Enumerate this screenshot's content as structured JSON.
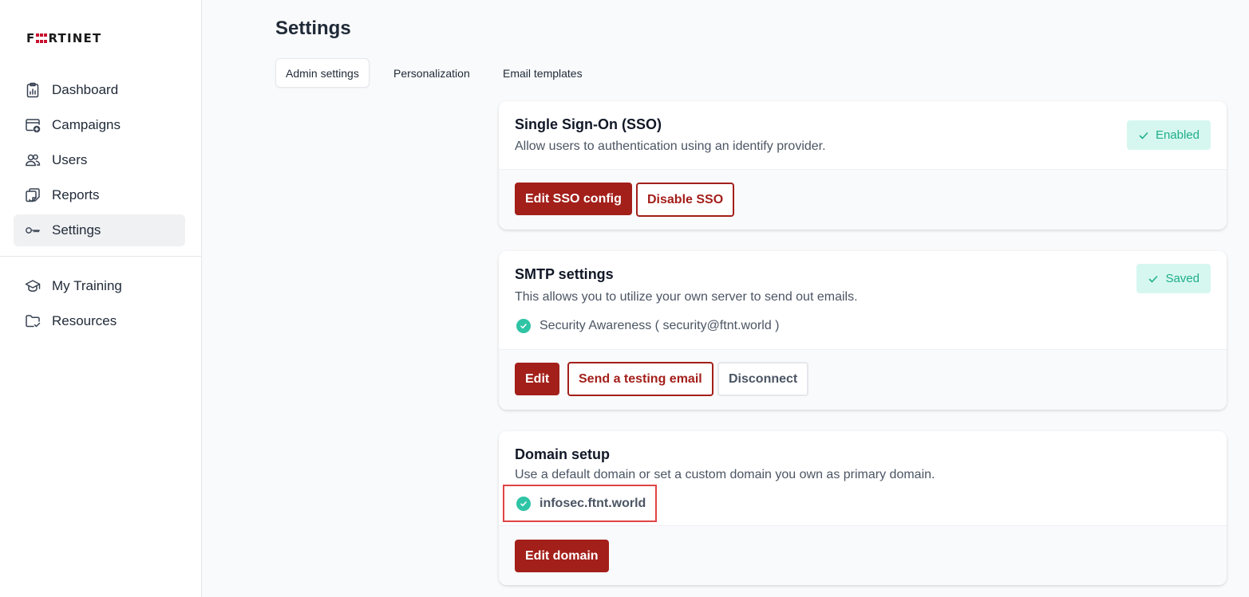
{
  "brand": {
    "logo_text": "FORTINET",
    "accent": "#a31f1a",
    "logo_red": "#c8102e"
  },
  "sidebar": {
    "items": [
      {
        "label": "Dashboard",
        "icon": "clipboard-chart-icon"
      },
      {
        "label": "Campaigns",
        "icon": "window-plus-icon"
      },
      {
        "label": "Users",
        "icon": "users-icon"
      },
      {
        "label": "Reports",
        "icon": "document-fold-icon"
      },
      {
        "label": "Settings",
        "icon": "key-icon",
        "active": true
      }
    ],
    "secondary_items": [
      {
        "label": "My Training",
        "icon": "graduation-cap-icon"
      },
      {
        "label": "Resources",
        "icon": "folder-check-icon"
      }
    ]
  },
  "page": {
    "title": "Settings"
  },
  "tabs": [
    {
      "label": "Admin settings",
      "active": true
    },
    {
      "label": "Personalization"
    },
    {
      "label": "Email templates"
    }
  ],
  "sso": {
    "title": "Single Sign-On (SSO)",
    "description": "Allow users to authentication using an identify provider.",
    "badge": "Enabled",
    "edit_button": "Edit SSO config",
    "disable_button": "Disable SSO"
  },
  "smtp": {
    "title": "SMTP settings",
    "description": "This allows you to utilize your own server to send out emails.",
    "badge": "Saved",
    "sender": "Security Awareness ( security@ftnt.world )",
    "edit_button": "Edit",
    "test_button": "Send a testing email",
    "disconnect_button": "Disconnect"
  },
  "domain": {
    "title": "Domain setup",
    "description": "Use a default domain or set a custom domain you own as primary domain.",
    "value": "infosec.ftnt.world",
    "edit_button": "Edit domain"
  },
  "colors": {
    "success_bg": "#d6f7ef",
    "success_text": "#1fae8c",
    "success_dot": "#2ec4a5",
    "highlight": "#e04444"
  }
}
